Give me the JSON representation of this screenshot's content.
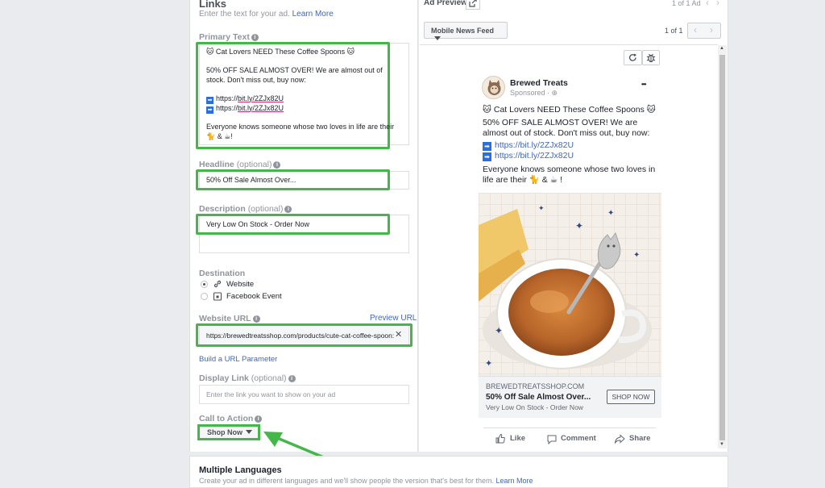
{
  "links": {
    "title": "Links",
    "subtitle": "Enter the text for your ad.",
    "learn_more": "Learn More",
    "info_glyph": "i"
  },
  "primary_text": {
    "label": "Primary Text",
    "line1": "Cat Lovers NEED These Coffee Spoons",
    "line2": "50% OFF SALE ALMOST OVER! We are almost out of",
    "line3": "stock. Don't miss out, buy now:",
    "link_prefix": "https://",
    "link_path": "bit.ly/2ZJx82U",
    "line_last1": "Everyone knows someone whose two loves in life are their",
    "line_last2": "& ",
    "line_last2_end": "!",
    "cat_emoji": "🐱",
    "cat2_emoji": "🐈",
    "cup_emoji": "☕",
    "arrow_glyph": "➡"
  },
  "headline": {
    "label": "Headline",
    "optional": "(optional)",
    "value": "50% Off Sale Almost Over..."
  },
  "description": {
    "label": "Description",
    "optional": "(optional)",
    "value": "Very Low On Stock - Order Now"
  },
  "destination": {
    "label": "Destination",
    "options": [
      "Website",
      "Facebook Event"
    ],
    "selected": "Website"
  },
  "website_url": {
    "label": "Website URL",
    "preview": "Preview URL",
    "value": "https://brewedtreatsshop.com/products/cute-cat-coffee-spoon:",
    "clear": "✕"
  },
  "url_param": "Build a URL Parameter",
  "display_link": {
    "label": "Display Link",
    "optional": "(optional)",
    "placeholder": "Enter the link you want to show on your ad"
  },
  "cta": {
    "label": "Call to Action",
    "value": "Shop Now"
  },
  "multiple_languages": {
    "title": "Multiple Languages",
    "subtitle": "Create your ad in different languages and we'll show people the version that's best for them.",
    "learn_more": "Learn More"
  },
  "ad_preview": {
    "title": "Ad Preview",
    "top_count": "1 of 1 Ad",
    "placement": "Mobile News Feed",
    "count": "1 of 1",
    "prev": "‹",
    "next": "›"
  },
  "post": {
    "page_name": "Brewed Treats",
    "sponsored": "Sponsored",
    "more": "•••",
    "line1": "Cat Lovers NEED These Coffee Spoons",
    "line2": "50% OFF SALE ALMOST OVER! We are",
    "line3": "almost out of stock. Don't miss out, buy now:",
    "link": "https://bit.ly/2ZJx82U",
    "line4": "Everyone knows someone whose two loves in",
    "line5_start": "life are their",
    "line5_mid": "&",
    "line5_end": "!",
    "domain": "BREWEDTREATSSHOP.COM",
    "headline": "50% Off Sale Almost Over...",
    "description": "Very Low On Stock - Order Now",
    "cta": "SHOP NOW",
    "actions": [
      "Like",
      "Comment",
      "Share"
    ]
  },
  "colors": {
    "highlight": "#44b749",
    "link": "#4267b2",
    "panel": "#ffffff",
    "background": "#e9ebee"
  }
}
